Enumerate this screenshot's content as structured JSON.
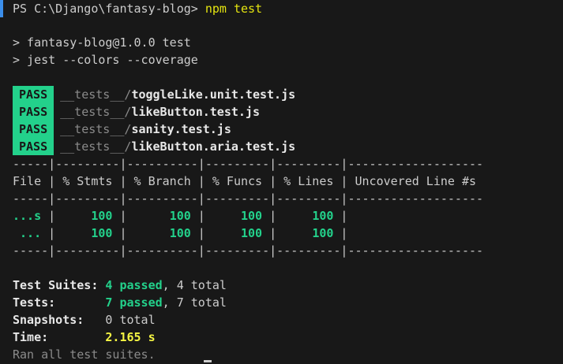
{
  "prompt": {
    "text": "PS C:\\Django\\fantasy-blog> ",
    "command": "npm test"
  },
  "script": {
    "line1": "> fantasy-blog@1.0.0 test",
    "line2": "> jest --colors --coverage"
  },
  "results": [
    {
      "status": "PASS",
      "dir": "__tests__/",
      "file": "toggleLike.unit.test.js"
    },
    {
      "status": "PASS",
      "dir": "__tests__/",
      "file": "likeButton.test.js"
    },
    {
      "status": "PASS",
      "dir": "__tests__/",
      "file": "sanity.test.js"
    },
    {
      "status": "PASS",
      "dir": "__tests__/",
      "file": "likeButton.aria.test.js"
    }
  ],
  "coverage": {
    "separator": "-----|---------|----------|---------|---------|-------------------",
    "header": "File | % Stmts | % Branch | % Funcs | % Lines | Uncovered Line #s ",
    "rows": [
      {
        "file": "...s",
        "stmts": "100",
        "branch": "100",
        "funcs": "100",
        "lines": "100"
      },
      {
        "file": " ...",
        "stmts": "100",
        "branch": "100",
        "funcs": "100",
        "lines": "100"
      }
    ]
  },
  "summary": {
    "suites_label": "Test Suites: ",
    "suites_passed": "4 passed",
    "suites_total": ", 4 total",
    "tests_label": "Tests:       ",
    "tests_passed": "7 passed",
    "tests_total": ", 7 total",
    "snapshots_label": "Snapshots:   ",
    "snapshots_value": "0 total",
    "time_label": "Time:        ",
    "time_value": "2.165 s",
    "ran_all": "Ran all test suites."
  },
  "colors": {
    "background": "#181818",
    "pass": "#23d18b",
    "command": "#e5e510",
    "time": "#f5f543"
  }
}
